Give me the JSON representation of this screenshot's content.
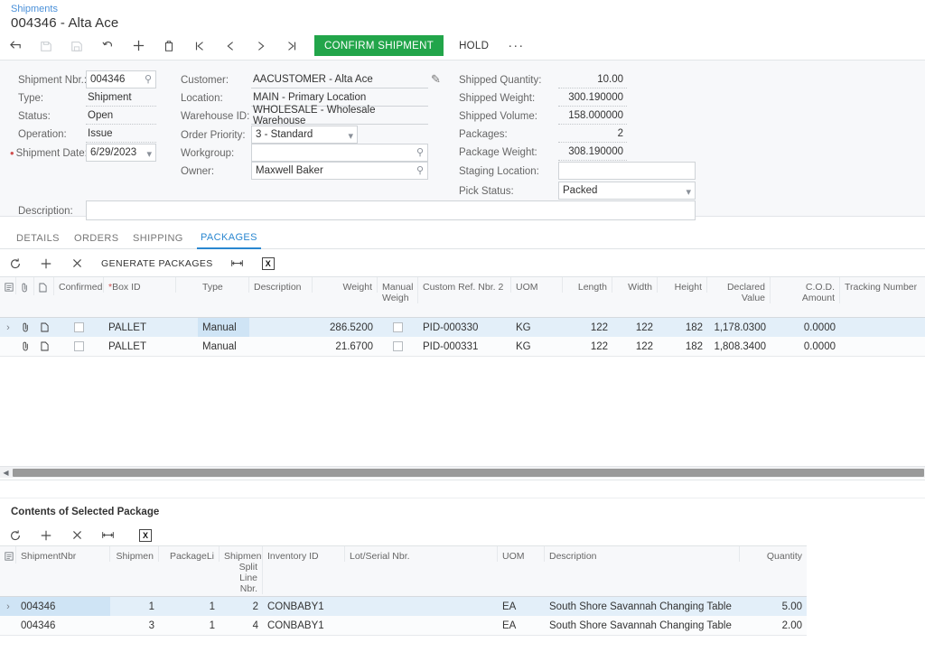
{
  "header": {
    "breadcrumb": "Shipments",
    "title": "004346 - Alta Ace"
  },
  "toolbar": {
    "icons": [
      {
        "name": "back-icon",
        "glyph": "↩",
        "disabled": false
      },
      {
        "name": "save-and-close-icon",
        "glyph": "⤦",
        "disabled": true
      },
      {
        "name": "save-icon",
        "glyph": "Ὃe",
        "disabled": true
      },
      {
        "name": "undo-icon",
        "glyph": "↶",
        "disabled": false
      },
      {
        "name": "add-new-record-icon",
        "glyph": "＋",
        "disabled": false
      },
      {
        "name": "delete-icon",
        "glyph": "🗑",
        "disabled": false
      },
      {
        "name": "first-record-icon",
        "glyph": "|‹",
        "disabled": false
      },
      {
        "name": "previous-record-icon",
        "glyph": "‹",
        "disabled": false
      },
      {
        "name": "next-record-icon",
        "glyph": "›",
        "disabled": false
      },
      {
        "name": "last-record-icon",
        "glyph": "›|",
        "disabled": false
      }
    ],
    "confirm_shipment_label": "CONFIRM SHIPMENT",
    "hold_label": "HOLD",
    "more_label": "···",
    "confirm_color": "#22a54a"
  },
  "form": {
    "left": [
      {
        "label": "Shipment Nbr.:",
        "value": "004346",
        "kind": "search-box",
        "required": false
      },
      {
        "label": "Type:",
        "value": "Shipment",
        "kind": "static",
        "required": false
      },
      {
        "label": "Status:",
        "value": "Open",
        "kind": "static",
        "required": false
      },
      {
        "label": "Operation:",
        "value": "Issue",
        "kind": "static",
        "required": false
      },
      {
        "label": "Shipment Date:",
        "value": "6/29/2023",
        "kind": "date-box",
        "required": true
      }
    ],
    "middle": [
      {
        "label": "Customer:",
        "value": "AACUSTOMER - Alta Ace",
        "kind": "underline",
        "required": false
      },
      {
        "label": "Location:",
        "value": "MAIN - Primary Location",
        "kind": "underline",
        "required": false
      },
      {
        "label": "Warehouse ID:",
        "value": "WHOLESALE - Wholesale Warehouse",
        "kind": "underline",
        "required": false
      },
      {
        "label": "Order Priority:",
        "value": "3 - Standard",
        "kind": "dropdown",
        "required": false
      },
      {
        "label": "Workgroup:",
        "value": "",
        "kind": "search-box",
        "required": false
      },
      {
        "label": "Owner:",
        "value": "Maxwell Baker",
        "kind": "search-box",
        "required": false
      }
    ],
    "right": [
      {
        "label": "Shipped Quantity:",
        "value": "10.00",
        "kind": "static-num",
        "required": false
      },
      {
        "label": "Shipped Weight:",
        "value": "300.190000",
        "kind": "static-num",
        "required": false
      },
      {
        "label": "Shipped Volume:",
        "value": "158.000000",
        "kind": "static-num",
        "required": false
      },
      {
        "label": "Packages:",
        "value": "2",
        "kind": "static-num",
        "required": false
      },
      {
        "label": "Package Weight:",
        "value": "308.190000",
        "kind": "static-num",
        "required": false
      },
      {
        "label": "Staging Location:",
        "value": "",
        "kind": "box",
        "required": false
      },
      {
        "label": "Pick Status:",
        "value": "Packed",
        "kind": "dropdown",
        "required": false
      }
    ],
    "description": {
      "label": "Description:",
      "value": "",
      "placeholder": ""
    },
    "edit_customer_icon": "pencil-icon"
  },
  "tabs": [
    {
      "label": "DETAILS",
      "active": false
    },
    {
      "label": "ORDERS",
      "active": false
    },
    {
      "label": "SHIPPING",
      "active": false
    },
    {
      "label": "PACKAGES",
      "active": true
    }
  ],
  "packages_toolbar": {
    "refresh_icon": "refresh-icon",
    "add_icon": "add-row-icon",
    "delete_icon": "delete-row-icon",
    "generate_label": "GENERATE PACKAGES",
    "fit_icon": "fit-columns-icon",
    "export_icon": "export-to-excel-icon",
    "export_glyph": "X"
  },
  "packages_grid": {
    "columns": [
      {
        "label": "",
        "name": "note-col",
        "align": "center"
      },
      {
        "label": "",
        "name": "attachment-col",
        "align": "center"
      },
      {
        "label": "",
        "name": "file-col",
        "align": "center"
      },
      {
        "label": "Confirmed",
        "name": "confirmed",
        "align": "center"
      },
      {
        "label": "Box ID",
        "name": "box-id",
        "align": "left",
        "required": true
      },
      {
        "label": "Type",
        "name": "type",
        "align": "left"
      },
      {
        "label": "Description",
        "name": "description",
        "align": "left"
      },
      {
        "label": "Weight",
        "name": "weight",
        "align": "right"
      },
      {
        "label": "Manual Weigh",
        "name": "manual-weight",
        "align": "left"
      },
      {
        "label": "Custom Ref. Nbr. 2",
        "name": "custom-ref-nbr-2",
        "align": "left"
      },
      {
        "label": "UOM",
        "name": "uom",
        "align": "left"
      },
      {
        "label": "Length",
        "name": "length",
        "align": "right"
      },
      {
        "label": "Width",
        "name": "width",
        "align": "right"
      },
      {
        "label": "Height",
        "name": "height",
        "align": "right"
      },
      {
        "label": "Declared Value",
        "name": "declared-value",
        "align": "right"
      },
      {
        "label": "C.O.D. Amount",
        "name": "cod-amount",
        "align": "right"
      },
      {
        "label": "Tracking Number",
        "name": "tracking-number",
        "align": "left"
      }
    ],
    "rows": [
      {
        "selected": true,
        "confirmed": false,
        "box_id": "PALLET",
        "type": "Manual",
        "description": "",
        "weight": "286.5200",
        "manual_weight": false,
        "custom_ref_nbr_2": "PID-000330",
        "uom": "KG",
        "length": "122",
        "width": "122",
        "height": "182",
        "declared_value": "1,178.0300",
        "cod_amount": "0.0000",
        "tracking_number": ""
      },
      {
        "selected": false,
        "confirmed": false,
        "box_id": "PALLET",
        "type": "Manual",
        "description": "",
        "weight": "21.6700",
        "manual_weight": false,
        "custom_ref_nbr_2": "PID-000331",
        "uom": "KG",
        "length": "122",
        "width": "122",
        "height": "182",
        "declared_value": "1,808.3400",
        "cod_amount": "0.0000",
        "tracking_number": ""
      }
    ]
  },
  "contents_section": {
    "title": "Contents of Selected Package",
    "toolbar": {
      "refresh_icon": "refresh-icon",
      "add_icon": "add-row-icon",
      "delete_icon": "delete-row-icon",
      "fit_icon": "fit-columns-icon",
      "export_icon": "export-to-excel-icon",
      "export_glyph": "X"
    },
    "columns": [
      {
        "label": "",
        "name": "note-col",
        "align": "center"
      },
      {
        "label": "ShipmentNbr",
        "name": "shipment-nbr",
        "align": "left"
      },
      {
        "label": "ShipmentSplitLineNbr",
        "name": "shipment-split-line-nbr",
        "align": "right"
      },
      {
        "label": "PackageLineNbr",
        "name": "package-line-nbr",
        "align": "right"
      },
      {
        "label": "Shipment Split Line Nbr.",
        "name": "shipment-split-line-nbr-2",
        "align": "right"
      },
      {
        "label": "Inventory ID",
        "name": "inventory-id",
        "align": "left"
      },
      {
        "label": "Lot/Serial Nbr.",
        "name": "lot-serial-nbr",
        "align": "left"
      },
      {
        "label": "UOM",
        "name": "uom",
        "align": "left"
      },
      {
        "label": "Description",
        "name": "description",
        "align": "left"
      },
      {
        "label": "Quantity",
        "name": "quantity",
        "align": "right"
      }
    ],
    "rows": [
      {
        "selected": true,
        "shipment_nbr": "004346",
        "shipment_split": "1",
        "package_line": "1",
        "shipment_split_2": "2",
        "inventory_id": "CONBABY1",
        "lot_serial_nbr": "",
        "uom": "EA",
        "description": "South Shore Savannah Changing Table",
        "quantity": "5.00"
      },
      {
        "selected": false,
        "shipment_nbr": "004346",
        "shipment_split": "3",
        "package_line": "1",
        "shipment_split_2": "4",
        "inventory_id": "CONBABY1",
        "lot_serial_nbr": "",
        "uom": "EA",
        "description": "South Shore Savannah Changing Table",
        "quantity": "2.00"
      }
    ]
  },
  "scrollbar": {
    "left_arrow": "◀",
    "right_arrow": "▶"
  }
}
